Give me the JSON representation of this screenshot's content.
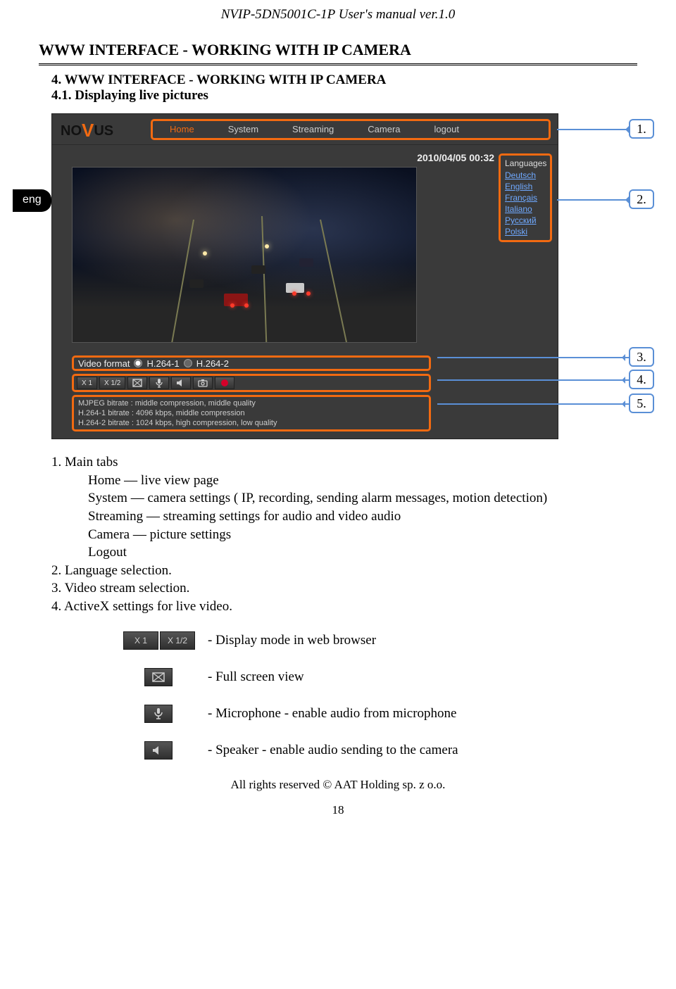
{
  "doc": {
    "header": "NVIP-5DN5001C-1P User's manual ver.1.0",
    "section_title": "WWW INTERFACE - WORKING WITH IP CAMERA",
    "h4": "4. WWW INTERFACE - WORKING WITH IP CAMERA",
    "h41": "4.1. Displaying live pictures",
    "lang_tab": "eng",
    "footer": "All rights reserved © AAT Holding sp. z o.o.",
    "page_number": "18"
  },
  "camui": {
    "logo_a": "NO",
    "logo_v": "V",
    "logo_b": "US",
    "nav": {
      "home": "Home",
      "system": "System",
      "streaming": "Streaming",
      "camera": "Camera",
      "logout": "logout"
    },
    "timestamp": "2010/04/05 00:32",
    "languages": {
      "header": "Languages",
      "items": [
        "Deutsch",
        "English",
        "Français",
        "Italiano",
        "Русский",
        "Polski"
      ]
    },
    "video_format": {
      "label": "Video format",
      "opt1": "H.264-1",
      "opt2": "H.264-2"
    },
    "controls": {
      "x1": "X 1",
      "xhalf": "X 1/2"
    },
    "bitrates": {
      "l1": "MJPEG bitrate : middle compression, middle quality",
      "l2": "H.264-1 bitrate : 4096 kbps, middle compression",
      "l3": "H.264-2 bitrate : 1024 kbps, high compression, low quality"
    }
  },
  "callouts": {
    "c1": "1.",
    "c2": "2.",
    "c3": "3.",
    "c4": "4.",
    "c5": "5."
  },
  "list": {
    "l1": "1. Main tabs",
    "l1a": "Home — live view page",
    "l1b": "System — camera settings  ( IP, recording, sending alarm messages, motion detection)",
    "l1c": "Streaming —  streaming settings for audio and video audio",
    "l1d": "Camera — picture settings",
    "l1e": "Logout",
    "l2": "2. Language selection.",
    "l3": "3. Video stream selection.",
    "l4": "4. ActiveX settings for live video."
  },
  "icons": {
    "x1": "X 1",
    "xhalf": "X 1/2",
    "d1": "- Display mode in web browser",
    "d2": "- Full screen view",
    "d3": "- Microphone - enable audio from microphone",
    "d4": "- Speaker - enable audio sending to the camera"
  }
}
